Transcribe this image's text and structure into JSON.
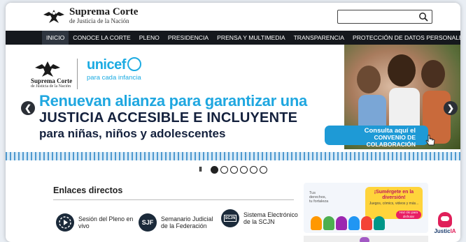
{
  "header": {
    "logo_title": "Suprema Corte",
    "logo_subtitle": "de Justicia de la Nación",
    "search_placeholder": ""
  },
  "nav": {
    "items": [
      {
        "label": "INICIO",
        "active": true
      },
      {
        "label": "CONOCE LA CORTE"
      },
      {
        "label": "PLENO"
      },
      {
        "label": "PRESIDENCIA"
      },
      {
        "label": "PRENSA Y MULTIMEDIA"
      },
      {
        "label": "TRANSPARENCIA"
      },
      {
        "label": "PROTECCIÓN DE DATOS PERSONALES"
      }
    ]
  },
  "banner": {
    "sc_title": "Suprema Corte",
    "sc_subtitle": "de Justicia de la Nación",
    "unicef_word": "unicef",
    "unicef_tagline": "para cada infancia",
    "headline_line1": "Renuevan alianza para garantizar una",
    "headline_line2": "JUSTICIA ACCESIBLE E INCLUYENTE",
    "headline_line3": "para niñas, niños y adolescentes",
    "cta_line1": "Consulta aquí el",
    "cta_line2": "CONVENIO DE COLABORACIÓN",
    "prev_icon": "chevron-left-icon",
    "next_icon": "chevron-right-icon"
  },
  "pager": {
    "pause_symbol": "II",
    "slide_count": 6,
    "active_index": 0
  },
  "enlaces": {
    "title": "Enlaces directos",
    "links": [
      {
        "label": "Sesión del Pleno en vivo",
        "icon": "play-icon"
      },
      {
        "label": "Semanario Judicial de la Federación",
        "icon": "sjf-icon",
        "abbr": "SJF"
      },
      {
        "label": "Sistema Electrónico de la SCJN",
        "icon": "scjn-icon",
        "abbr": "SCJN"
      }
    ]
  },
  "promo": {
    "tag": "Tus derechos, tu fortaleza",
    "headline": "¡Sumérgete en la diversión!",
    "subline": "Juegos, cómics, videos y más...",
    "button": "Haz clic para disfrutar"
  },
  "bot": {
    "label_prefix": "Justic",
    "label_suffix": "IA"
  },
  "colors": {
    "nav_bg": "#15181d",
    "accent_blue": "#1fa7e0",
    "navy": "#14213d",
    "bot_pink": "#e01f5a"
  }
}
